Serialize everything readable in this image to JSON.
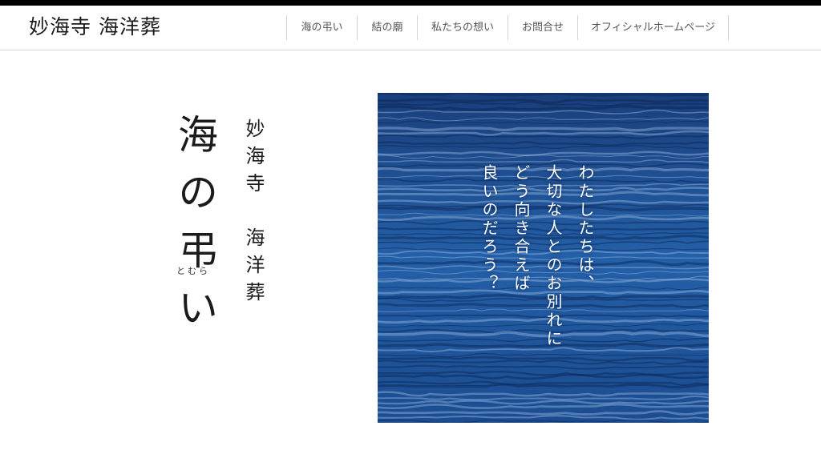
{
  "header": {
    "site_title": "妙海寺 海洋葬",
    "nav": [
      {
        "label": "海の弔い"
      },
      {
        "label": "結の廟"
      },
      {
        "label": "私たちの想い"
      },
      {
        "label": "お問合せ"
      },
      {
        "label": "オフィシャルホームページ"
      }
    ]
  },
  "hero": {
    "title": "海の弔い",
    "ruby": "とむら",
    "subtitle": "妙海寺　海洋葬",
    "poem": "わたしたちは、\n大切な人とのお別れに\nどう向き合えば\n良いのだろう？"
  },
  "colors": {
    "topbar": "#000000",
    "sea": "#1d4f93",
    "text": "#1b1b1b"
  }
}
